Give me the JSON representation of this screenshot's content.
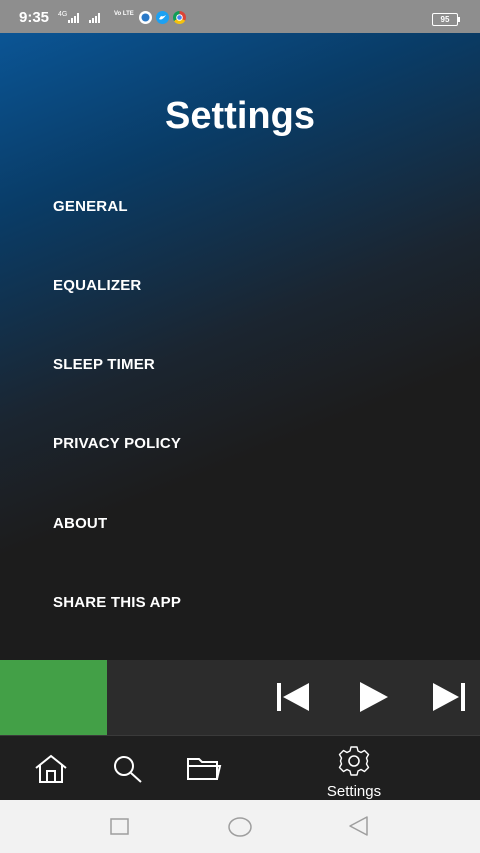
{
  "status_bar": {
    "time": "9:35",
    "network_type": "4G",
    "volte_label": "Vo LTE",
    "battery_level": "95",
    "notification_icons": [
      "cloud-icon",
      "twitter-icon",
      "chrome-icon"
    ]
  },
  "settings": {
    "title": "Settings",
    "menu": [
      {
        "label": "GENERAL"
      },
      {
        "label": "EQUALIZER"
      },
      {
        "label": "SLEEP TIMER"
      },
      {
        "label": "PRIVACY POLICY"
      },
      {
        "label": "ABOUT"
      },
      {
        "label": "SHARE THIS APP"
      }
    ]
  },
  "player": {
    "accent_color": "#43a047",
    "controls": [
      "skip-previous-icon",
      "play-icon",
      "skip-next-icon"
    ]
  },
  "bottom_nav": {
    "items": [
      {
        "icon": "home-icon"
      },
      {
        "icon": "search-icon"
      },
      {
        "icon": "folder-icon"
      },
      {
        "icon": "gear-icon",
        "label": "Settings",
        "active": true
      }
    ]
  },
  "system_nav": {
    "buttons": [
      "recent-apps-icon",
      "home-circle-icon",
      "back-triangle-icon"
    ]
  }
}
